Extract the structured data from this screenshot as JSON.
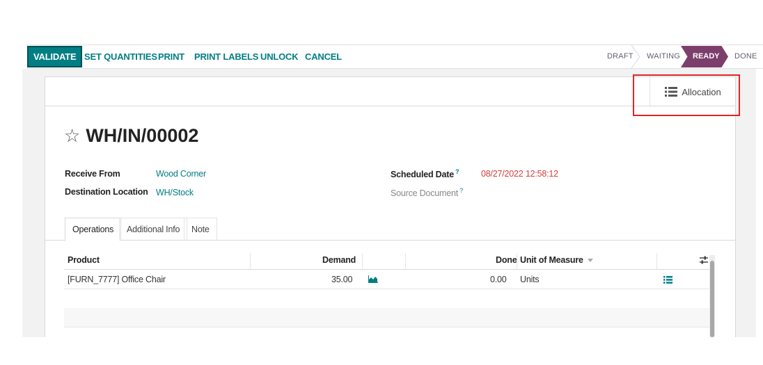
{
  "actions": {
    "validate": "VALIDATE",
    "set_quantities": "SET QUANTITIES",
    "print": "PRINT",
    "print_labels": "PRINT LABELS",
    "unlock": "UNLOCK",
    "cancel": "CANCEL"
  },
  "statusbar": {
    "draft": "DRAFT",
    "waiting": "WAITING",
    "ready": "READY",
    "done": "DONE",
    "current": "READY"
  },
  "smart_button": {
    "label": "Allocation",
    "icon": "list-icon"
  },
  "record": {
    "name": "WH/IN/00002"
  },
  "fields": {
    "receive_from": {
      "label": "Receive From",
      "value": "Wood Corner"
    },
    "destination": {
      "label": "Destination Location",
      "value": "WH/Stock"
    },
    "scheduled_date": {
      "label": "Scheduled Date",
      "help": "?",
      "value": "08/27/2022 12:58:12"
    },
    "source_document": {
      "label": "Source Document",
      "help": "?",
      "value": ""
    }
  },
  "tabs": [
    "Operations",
    "Additional Info",
    "Note"
  ],
  "table": {
    "headers": {
      "product": "Product",
      "demand": "Demand",
      "done": "Done",
      "uom": "Unit of Measure"
    },
    "rows": [
      {
        "product": "[FURN_7777] Office Chair",
        "demand": "35.00",
        "done": "0.00",
        "uom": "Units"
      }
    ]
  },
  "colors": {
    "primary": "#017e84",
    "ready_status": "#7c3e6b",
    "date_alert": "#d23f3a",
    "highlight_box": "#e12525"
  }
}
